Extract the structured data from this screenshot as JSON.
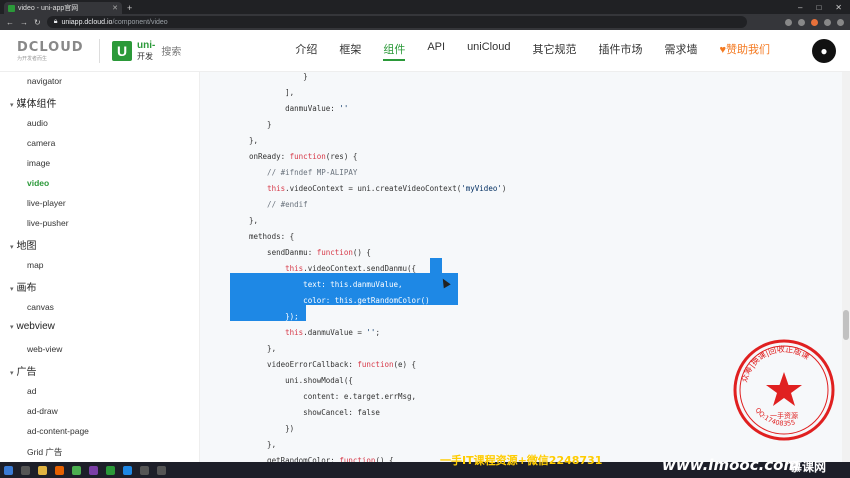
{
  "browser": {
    "tab_title": "video - uni-app官网",
    "url_host": "uniapp.dcloud.io",
    "url_path": "/component/video"
  },
  "header": {
    "dcloud_logo": "DCLOUD",
    "dcloud_slogan": "为开发者而生",
    "uni_text": "uni-",
    "uni_sub": "开发",
    "search_placeholder": "搜索",
    "nav": [
      "介绍",
      "框架",
      "组件",
      "API",
      "uniCloud",
      "其它规范",
      "插件市场",
      "需求墙",
      "♥赞助我们"
    ]
  },
  "sidebar": {
    "items": [
      {
        "type": "item",
        "label": "navigator"
      },
      {
        "type": "group",
        "label": "媒体组件"
      },
      {
        "type": "item",
        "label": "audio"
      },
      {
        "type": "item",
        "label": "camera"
      },
      {
        "type": "item",
        "label": "image"
      },
      {
        "type": "item",
        "label": "video",
        "active": true
      },
      {
        "type": "item",
        "label": "live-player"
      },
      {
        "type": "item",
        "label": "live-pusher"
      },
      {
        "type": "group",
        "label": "地图"
      },
      {
        "type": "item",
        "label": "map"
      },
      {
        "type": "group",
        "label": "画布"
      },
      {
        "type": "item",
        "label": "canvas"
      },
      {
        "type": "group",
        "label": "webview"
      },
      {
        "type": "item",
        "label": "web-view"
      },
      {
        "type": "group",
        "label": "广告"
      },
      {
        "type": "item",
        "label": "ad"
      },
      {
        "type": "item",
        "label": "ad-draw"
      },
      {
        "type": "item",
        "label": "ad-content-page"
      },
      {
        "type": "item",
        "label": "Grid 广告"
      }
    ]
  },
  "code": {
    "lines": [
      "            }",
      "        ],",
      "        danmuValue: ''",
      "    }",
      "},",
      "onReady: function(res) {",
      "    // #ifndef MP-ALIPAY",
      "    this.videoContext = uni.createVideoContext('myVideo')",
      "    // #endif",
      "},",
      "methods: {",
      "    sendDanmu: function() {",
      "        this.videoContext.sendDanmu({",
      "            text: this.danmuValue,",
      "            color: this.getRandomColor()",
      "        });",
      "        this.danmuValue = '';",
      "    },",
      "    videoErrorCallback: function(e) {",
      "        uni.showModal({",
      "            content: e.target.errMsg,",
      "            showCancel: false",
      "        })",
      "    },",
      "    getRandomColor: function() {"
    ]
  },
  "watermarks": {
    "text1": "一手IT课程资源+微信2248731",
    "text2": "www.imooc.com",
    "text3": "慕课网",
    "stamp_text": "众筹|换课|回收正版课",
    "stamp_center": "一手资源",
    "stamp_number": "QQ:17408355"
  },
  "colors": {
    "brand": "#2b9939",
    "selection": "#1e88e5",
    "stamp": "#e02020"
  }
}
